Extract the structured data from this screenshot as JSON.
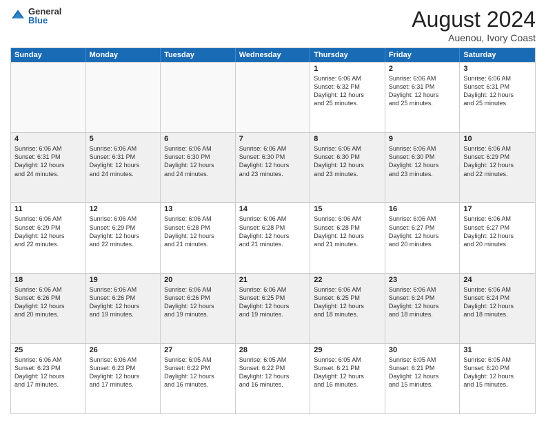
{
  "logo": {
    "general": "General",
    "blue": "Blue"
  },
  "header": {
    "month": "August 2024",
    "location": "Auenou, Ivory Coast"
  },
  "days": [
    "Sunday",
    "Monday",
    "Tuesday",
    "Wednesday",
    "Thursday",
    "Friday",
    "Saturday"
  ],
  "rows": [
    [
      {
        "day": "",
        "text": "",
        "empty": true
      },
      {
        "day": "",
        "text": "",
        "empty": true
      },
      {
        "day": "",
        "text": "",
        "empty": true
      },
      {
        "day": "",
        "text": "",
        "empty": true
      },
      {
        "day": "1",
        "text": "Sunrise: 6:06 AM\nSunset: 6:32 PM\nDaylight: 12 hours\nand 25 minutes."
      },
      {
        "day": "2",
        "text": "Sunrise: 6:06 AM\nSunset: 6:31 PM\nDaylight: 12 hours\nand 25 minutes."
      },
      {
        "day": "3",
        "text": "Sunrise: 6:06 AM\nSunset: 6:31 PM\nDaylight: 12 hours\nand 25 minutes."
      }
    ],
    [
      {
        "day": "4",
        "text": "Sunrise: 6:06 AM\nSunset: 6:31 PM\nDaylight: 12 hours\nand 24 minutes.",
        "shaded": true
      },
      {
        "day": "5",
        "text": "Sunrise: 6:06 AM\nSunset: 6:31 PM\nDaylight: 12 hours\nand 24 minutes.",
        "shaded": true
      },
      {
        "day": "6",
        "text": "Sunrise: 6:06 AM\nSunset: 6:30 PM\nDaylight: 12 hours\nand 24 minutes.",
        "shaded": true
      },
      {
        "day": "7",
        "text": "Sunrise: 6:06 AM\nSunset: 6:30 PM\nDaylight: 12 hours\nand 23 minutes.",
        "shaded": true
      },
      {
        "day": "8",
        "text": "Sunrise: 6:06 AM\nSunset: 6:30 PM\nDaylight: 12 hours\nand 23 minutes.",
        "shaded": true
      },
      {
        "day": "9",
        "text": "Sunrise: 6:06 AM\nSunset: 6:30 PM\nDaylight: 12 hours\nand 23 minutes.",
        "shaded": true
      },
      {
        "day": "10",
        "text": "Sunrise: 6:06 AM\nSunset: 6:29 PM\nDaylight: 12 hours\nand 22 minutes.",
        "shaded": true
      }
    ],
    [
      {
        "day": "11",
        "text": "Sunrise: 6:06 AM\nSunset: 6:29 PM\nDaylight: 12 hours\nand 22 minutes."
      },
      {
        "day": "12",
        "text": "Sunrise: 6:06 AM\nSunset: 6:29 PM\nDaylight: 12 hours\nand 22 minutes."
      },
      {
        "day": "13",
        "text": "Sunrise: 6:06 AM\nSunset: 6:28 PM\nDaylight: 12 hours\nand 21 minutes."
      },
      {
        "day": "14",
        "text": "Sunrise: 6:06 AM\nSunset: 6:28 PM\nDaylight: 12 hours\nand 21 minutes."
      },
      {
        "day": "15",
        "text": "Sunrise: 6:06 AM\nSunset: 6:28 PM\nDaylight: 12 hours\nand 21 minutes."
      },
      {
        "day": "16",
        "text": "Sunrise: 6:06 AM\nSunset: 6:27 PM\nDaylight: 12 hours\nand 20 minutes."
      },
      {
        "day": "17",
        "text": "Sunrise: 6:06 AM\nSunset: 6:27 PM\nDaylight: 12 hours\nand 20 minutes."
      }
    ],
    [
      {
        "day": "18",
        "text": "Sunrise: 6:06 AM\nSunset: 6:26 PM\nDaylight: 12 hours\nand 20 minutes.",
        "shaded": true
      },
      {
        "day": "19",
        "text": "Sunrise: 6:06 AM\nSunset: 6:26 PM\nDaylight: 12 hours\nand 19 minutes.",
        "shaded": true
      },
      {
        "day": "20",
        "text": "Sunrise: 6:06 AM\nSunset: 6:26 PM\nDaylight: 12 hours\nand 19 minutes.",
        "shaded": true
      },
      {
        "day": "21",
        "text": "Sunrise: 6:06 AM\nSunset: 6:25 PM\nDaylight: 12 hours\nand 19 minutes.",
        "shaded": true
      },
      {
        "day": "22",
        "text": "Sunrise: 6:06 AM\nSunset: 6:25 PM\nDaylight: 12 hours\nand 18 minutes.",
        "shaded": true
      },
      {
        "day": "23",
        "text": "Sunrise: 6:06 AM\nSunset: 6:24 PM\nDaylight: 12 hours\nand 18 minutes.",
        "shaded": true
      },
      {
        "day": "24",
        "text": "Sunrise: 6:06 AM\nSunset: 6:24 PM\nDaylight: 12 hours\nand 18 minutes.",
        "shaded": true
      }
    ],
    [
      {
        "day": "25",
        "text": "Sunrise: 6:06 AM\nSunset: 6:23 PM\nDaylight: 12 hours\nand 17 minutes."
      },
      {
        "day": "26",
        "text": "Sunrise: 6:06 AM\nSunset: 6:23 PM\nDaylight: 12 hours\nand 17 minutes."
      },
      {
        "day": "27",
        "text": "Sunrise: 6:05 AM\nSunset: 6:22 PM\nDaylight: 12 hours\nand 16 minutes."
      },
      {
        "day": "28",
        "text": "Sunrise: 6:05 AM\nSunset: 6:22 PM\nDaylight: 12 hours\nand 16 minutes."
      },
      {
        "day": "29",
        "text": "Sunrise: 6:05 AM\nSunset: 6:21 PM\nDaylight: 12 hours\nand 16 minutes."
      },
      {
        "day": "30",
        "text": "Sunrise: 6:05 AM\nSunset: 6:21 PM\nDaylight: 12 hours\nand 15 minutes."
      },
      {
        "day": "31",
        "text": "Sunrise: 6:05 AM\nSunset: 6:20 PM\nDaylight: 12 hours\nand 15 minutes."
      }
    ]
  ]
}
